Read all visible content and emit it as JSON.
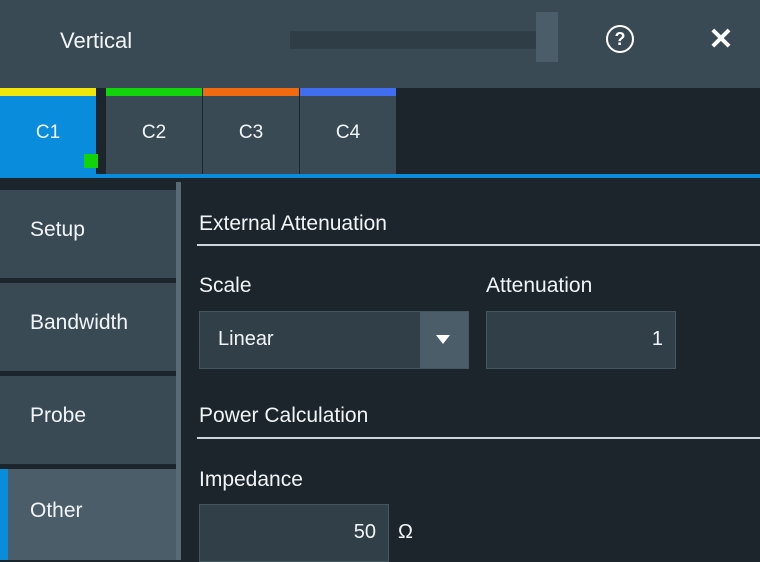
{
  "window": {
    "title": "Vertical",
    "help_icon": "help-icon",
    "close_icon": "close-icon"
  },
  "channel_tabs": [
    {
      "label": "C1",
      "color": "#f0e60a",
      "active": true
    },
    {
      "label": "C2",
      "color": "#12d40a",
      "active": false
    },
    {
      "label": "C3",
      "color": "#f26a0f",
      "active": false
    },
    {
      "label": "C4",
      "color": "#3f6ef0",
      "active": false
    }
  ],
  "sidebar": {
    "items": [
      {
        "label": "Setup"
      },
      {
        "label": "Bandwidth"
      },
      {
        "label": "Probe"
      },
      {
        "label": "Other"
      }
    ],
    "active": "Other"
  },
  "external_attenuation": {
    "heading": "External Attenuation",
    "scale_label": "Scale",
    "scale_value": "Linear",
    "attenuation_label": "Attenuation",
    "attenuation_value": "1"
  },
  "power_calculation": {
    "heading": "Power Calculation",
    "impedance_label": "Impedance",
    "impedance_value": "50",
    "impedance_unit": "Ω"
  },
  "colors": {
    "accent": "#0a8cdc",
    "channel_indicator": "#12d40a"
  }
}
